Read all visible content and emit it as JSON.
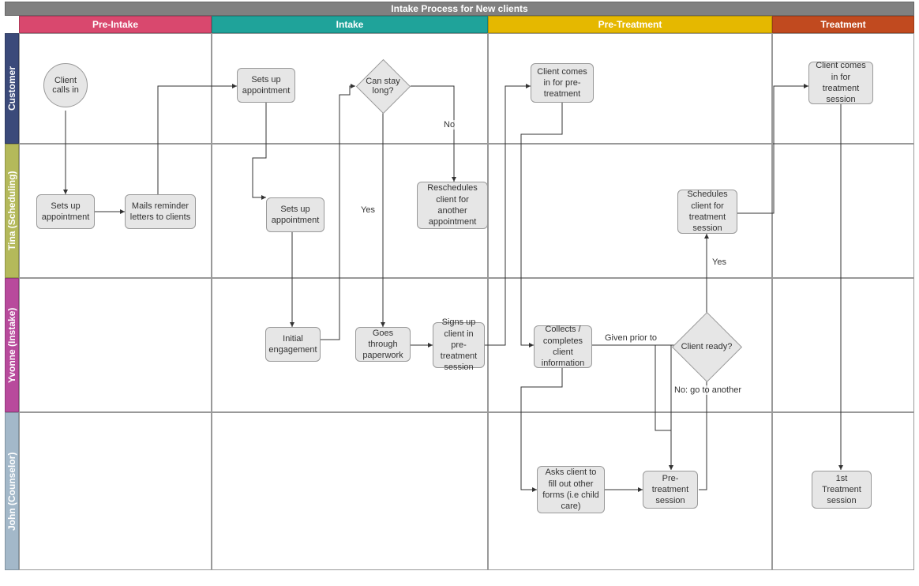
{
  "title": "Intake Process for New clients",
  "phases": {
    "pre_intake": "Pre-Intake",
    "intake": "Intake",
    "pre_treatment": "Pre-Treatment",
    "treatment": "Treatment"
  },
  "lanes": {
    "customer": "Customer",
    "tina": "Tina (Scheduling)",
    "yvonne": "Yvonne (Instake)",
    "john": "John (Counselor)"
  },
  "nodes": {
    "client_calls_in": "Client calls in",
    "sets_up_appt_1": "Sets up appointment",
    "mails_reminder": "Mails reminder letters to clients",
    "sets_up_appt_cust": "Sets up appointment",
    "sets_up_appt_tina2": "Sets up appointment",
    "can_stay_long": "Can stay long?",
    "reschedules": "Reschedules client for another appointment",
    "initial_engagement": "Initial engagement",
    "goes_through": "Goes through paperwork",
    "signs_up": "Signs up client in pre-treatment session",
    "client_pretreat": "Client comes in for pre-treatment",
    "collects": "Collects / completes client information",
    "asks_client": "Asks client to fill out other forms (i.e child care)",
    "pretreat_session": "Pre-treatment session",
    "client_ready": "Client ready?",
    "schedules_treatment": "Schedules client for treatment session",
    "client_treatment": "Client comes in for treatment session",
    "first_treatment": "1st Treatment session"
  },
  "edge_labels": {
    "yes": "Yes",
    "no": "No",
    "given_prior": "Given prior to",
    "no_go": "No: go to another",
    "yes2": "Yes"
  },
  "colors": {
    "pre_intake": "#D9486E",
    "intake": "#1FA39A",
    "pre_treatment": "#E5B800",
    "treatment": "#C14A1F",
    "customer": "#3B4A7A",
    "tina": "#B4B95A",
    "yvonne": "#B84A9C",
    "john": "#A3B8C9"
  }
}
